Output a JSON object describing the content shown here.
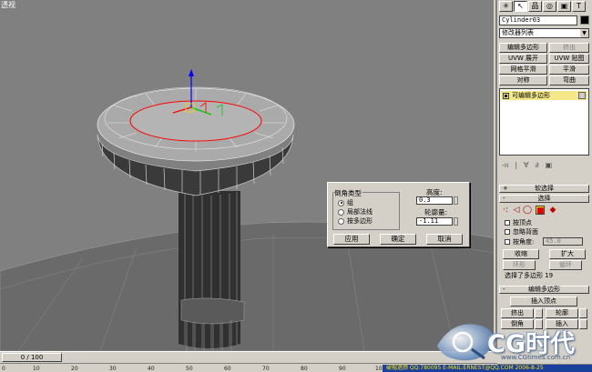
{
  "viewport": {
    "label": "透视"
  },
  "dialog": {
    "group_label": "倒角类型",
    "options": [
      "组",
      "局部法线",
      "按多边形"
    ],
    "selected_option": "组",
    "height_label": "高度:",
    "height_value": "0.3",
    "outline_label": "轮廓量:",
    "outline_value": "-1.11",
    "apply_label": "应用",
    "ok_label": "确定",
    "cancel_label": "取消"
  },
  "panel": {
    "tab_icons": [
      "create-icon",
      "modify-icon",
      "hierarchy-icon",
      "motion-icon",
      "display-icon",
      "utilities-icon"
    ],
    "tab_glyphs": [
      "✳",
      "↖",
      "品",
      "◎",
      "▣",
      "T"
    ],
    "object_name": "Cylinder03",
    "object_color": "#000000",
    "modifier_list": "修改器列表",
    "modifier_buttons": [
      {
        "label": "编辑多边形",
        "dim": false
      },
      {
        "label": "挤出",
        "dim": true
      },
      {
        "label": "UVW 展开",
        "dim": false
      },
      {
        "label": "UVW 贴图",
        "dim": false
      },
      {
        "label": "网格平滑",
        "dim": false
      },
      {
        "label": "平滑",
        "dim": false
      },
      {
        "label": "对称",
        "dim": false
      },
      {
        "label": "弯曲",
        "dim": false
      }
    ],
    "stack_item": "可编辑多边形",
    "stack_tools": [
      "-ıı",
      "|",
      "∀",
      "∂",
      "▣"
    ],
    "soft_select_label": "软选择",
    "soft_select_sign": "+",
    "select_label": "选择",
    "select_sign": "-",
    "sub_icons": [
      "vertex-icon",
      "edge-icon",
      "border-icon",
      "polygon-icon",
      "element-icon"
    ],
    "sub_glyphs": [
      "·:",
      "◁",
      "◯",
      "■",
      "◆"
    ],
    "by_vertex_label": "按顶点",
    "ignore_backfacing_label": "忽略背面",
    "by_angle_label": "按角度:",
    "by_angle_value": "45.0",
    "shrink_label": "收缩",
    "grow_label": "扩大",
    "ring_label": "环形",
    "loop_label": "循环",
    "selection_info": "选择了多边形 19",
    "edit_polys_label": "编辑多边形",
    "edit_polys_sign": "-",
    "insert_vertex_label": "插入顶点",
    "extrude_label": "挤出",
    "outline_label": "轮廓",
    "bevel_label": "倒角",
    "inset_label": "插入"
  },
  "timeline": {
    "slider": "0 / 100",
    "ticks": [
      "0",
      "10",
      "20",
      "30",
      "40",
      "50",
      "60",
      "70",
      "80",
      "90",
      "100"
    ]
  },
  "footer": {
    "status": "破帽遮颜  QQ:780095  E-MAIL:ERNEST@QQ.COM  2006-8-25",
    "logo_text": "CG时代",
    "logo_url": "www.CGtimes.com.cn"
  },
  "colors": {
    "viewport_bg": "#808080",
    "panel_bg": "#d4d0c8",
    "selection_red": "#ff0000",
    "stack_highlight": "#f5e88a",
    "footer_blue": "#1a3f9c",
    "gizmo_x": "#ff0000",
    "gizmo_y": "#00c800",
    "gizmo_z": "#0000ff"
  }
}
